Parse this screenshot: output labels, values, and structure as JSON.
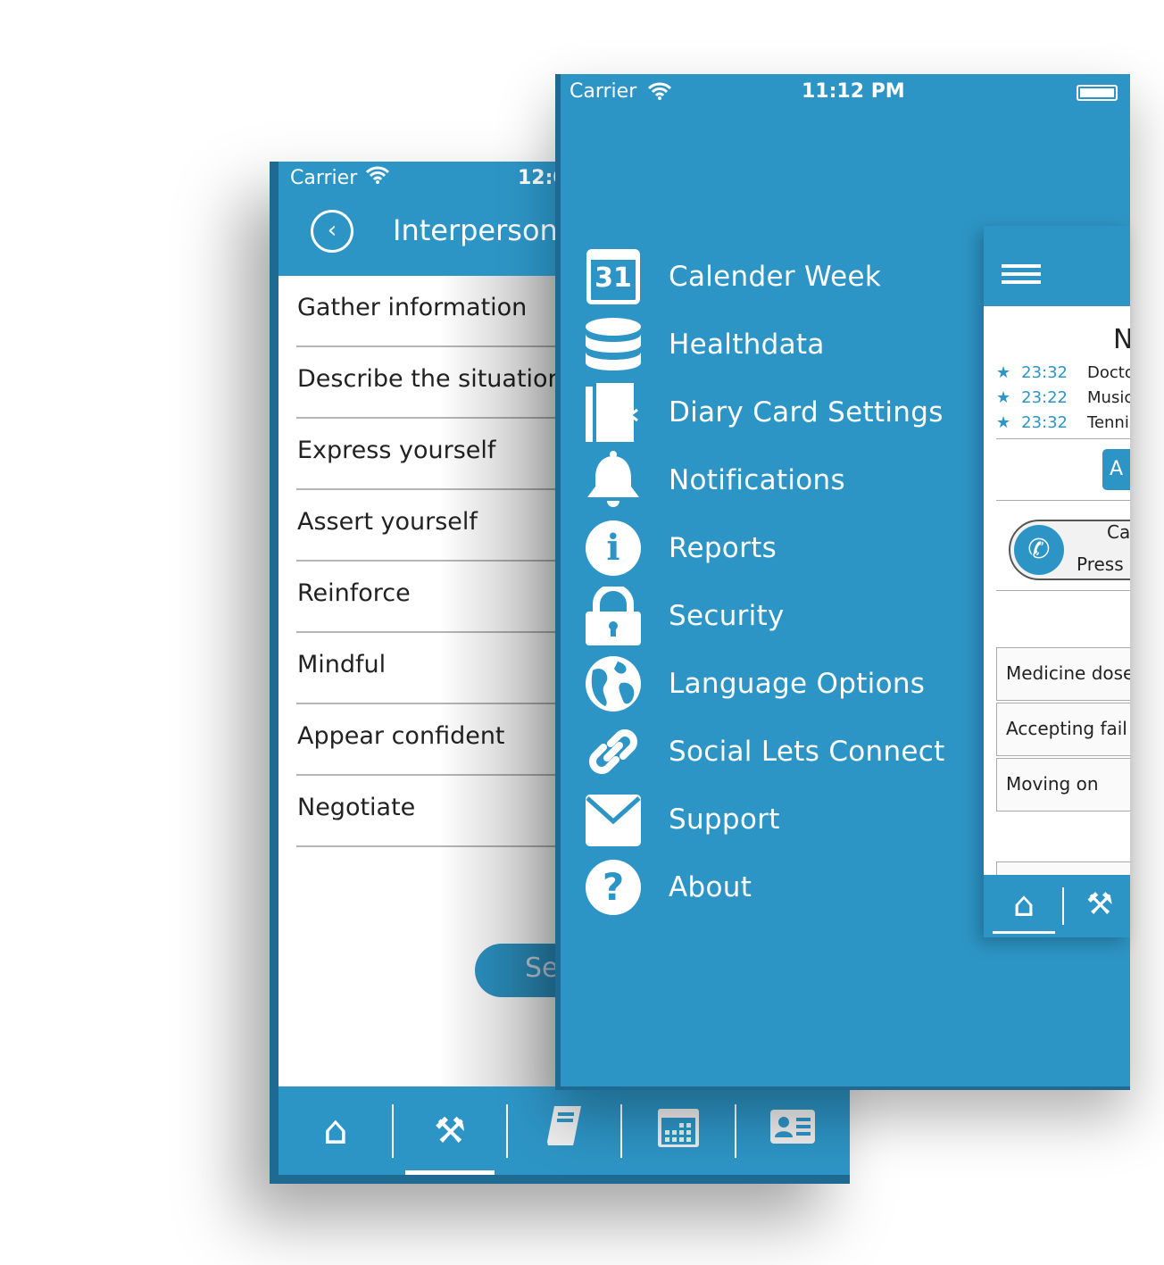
{
  "back_phone": {
    "status": {
      "carrier": "Carrier",
      "time": "12:0"
    },
    "header": {
      "title": "Interpersonal"
    },
    "items": [
      "Gather information",
      "Describe the situation",
      "Express yourself",
      "Assert yourself",
      "Reinforce",
      "Mindful",
      "Appear confident",
      "Negotiate"
    ],
    "button_label": "Se",
    "tabs": [
      {
        "icon": "home-icon"
      },
      {
        "icon": "tools-icon",
        "active": true
      },
      {
        "icon": "book-icon"
      },
      {
        "icon": "calendar-icon"
      },
      {
        "icon": "contact-card-icon"
      }
    ]
  },
  "front_phone": {
    "status": {
      "carrier": "Carrier",
      "time": "11:12 PM"
    },
    "menu": [
      {
        "label": "Calender Week",
        "icon": "calendar-31-icon",
        "glyph": "31"
      },
      {
        "label": "Healthdata",
        "icon": "database-icon"
      },
      {
        "label": "Diary Card Settings",
        "icon": "diary-icon"
      },
      {
        "label": "Notifications",
        "icon": "bell-icon"
      },
      {
        "label": "Reports",
        "icon": "info-icon",
        "glyph": "i"
      },
      {
        "label": "Security",
        "icon": "lock-icon"
      },
      {
        "label": "Language Options",
        "icon": "globe-icon"
      },
      {
        "label": "Social Lets Connect",
        "icon": "link-icon"
      },
      {
        "label": "Support",
        "icon": "envelope-icon"
      },
      {
        "label": "About",
        "icon": "question-icon",
        "glyph": "?"
      }
    ]
  },
  "card": {
    "title": "N",
    "events": [
      {
        "time": "23:32",
        "name": "Docto"
      },
      {
        "time": "23:22",
        "name": "Music"
      },
      {
        "time": "23:32",
        "name": "Tennis"
      }
    ],
    "add_button": "A",
    "call": {
      "title": "Ca",
      "subtitle": "Press e"
    },
    "boxes": [
      "Medicine dose",
      "Accepting fail",
      "Moving on"
    ]
  },
  "colors": {
    "primary": "#2d95c6",
    "edge": "#1f6a93"
  }
}
